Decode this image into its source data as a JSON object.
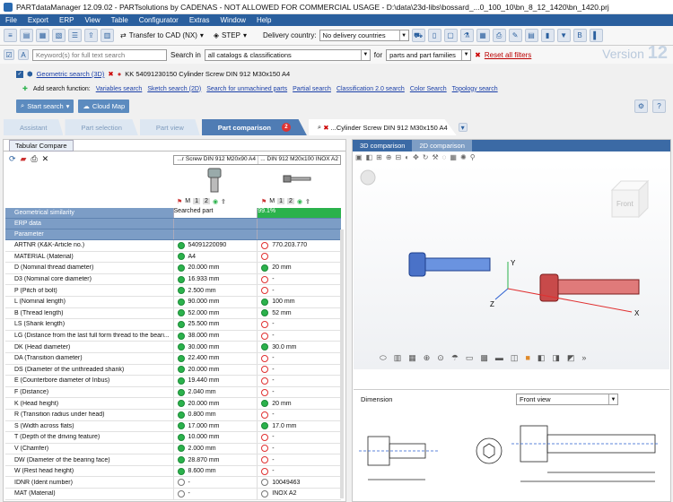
{
  "window": {
    "title": "PARTdataManager 12.09.02 - PARTsolutions by CADENAS - NOT ALLOWED FOR COMMERCIAL USAGE - D:\\data\\23d-libs\\bossard_...0_100_10\\bn_8_12_1420\\bn_1420.prj"
  },
  "menu": [
    "File",
    "Export",
    "ERP",
    "View",
    "Table",
    "Configurator",
    "Extras",
    "Window",
    "Help"
  ],
  "toolbar": {
    "transfer_label": "Transfer to CAD (NX)",
    "step_label": "STEP",
    "delivery_label": "Delivery country:",
    "delivery_value": "No delivery countries"
  },
  "search": {
    "placeholder": "Keyword(s) for full text search",
    "search_in_label": "Search in",
    "search_in_value": "all catalogs & classifications",
    "for_label": "for",
    "for_value": "parts and part families",
    "reset_label": "Reset all filters",
    "version_label": "Version",
    "version_number": "12"
  },
  "geometric": {
    "label": "Geometric search (3D)",
    "part": "KK 54091230150 Cylinder Screw DIN 912 M30x150 A4"
  },
  "functions": {
    "add_label": "Add search function:",
    "items": [
      "Variables search",
      "Sketch search (2D)",
      "Search for unmachined parts",
      "Partial search",
      "Classification 2.0 search",
      "Color Search",
      "Topology search"
    ]
  },
  "buttons": {
    "start_search": "Start search",
    "cloud_map": "Cloud Map"
  },
  "tabs": [
    {
      "label": "Assistant"
    },
    {
      "label": "Part selection"
    },
    {
      "label": "Part view"
    },
    {
      "label": "Part comparison",
      "badge": "2"
    },
    {
      "label": "...Cylinder Screw DIN 912 M30x150 A4"
    }
  ],
  "compare": {
    "tab_label": "Tabular Compare",
    "col1_header": "...r Screw DIN 912 M20x90 A4",
    "col2_header": "... DIN 912 M20x100 INOX A2",
    "searched_label": "Searched part",
    "similarity": "99.1%",
    "col1_number": "2",
    "col2_number": "2",
    "m_label": "M",
    "one_label": "1"
  },
  "sections": {
    "geometric": "Geometrical similarity",
    "erp": "ERP data",
    "parameter": "Parameter"
  },
  "rows": [
    {
      "name": "ARTNR (K&K-Article no.)",
      "v1": "54091220090",
      "v2": "770.203.770",
      "s1": "dot",
      "s2": "ring"
    },
    {
      "name": "MATERIAL (Material)",
      "v1": "A4",
      "v2": "",
      "s1": "dot",
      "s2": "ring"
    },
    {
      "name": "D (Nominal thread diameter)",
      "v1": "20.000 mm",
      "v2": "20 mm",
      "s1": "dot",
      "s2": "dot"
    },
    {
      "name": "D3 (Nominal core diameter)",
      "v1": "16.933 mm",
      "v2": "-",
      "s1": "dot",
      "s2": "ring"
    },
    {
      "name": "P (Pitch of bolt)",
      "v1": "2.500 mm",
      "v2": "-",
      "s1": "dot",
      "s2": "ring"
    },
    {
      "name": "L (Nominal length)",
      "v1": "90.000 mm",
      "v2": "100 mm",
      "s1": "dot",
      "s2": "dot"
    },
    {
      "name": "B (Thread length)",
      "v1": "52.000 mm",
      "v2": "52 mm",
      "s1": "dot",
      "s2": "dot"
    },
    {
      "name": "LS (Shank length)",
      "v1": "25.500 mm",
      "v2": "-",
      "s1": "dot",
      "s2": "ring"
    },
    {
      "name": "LG (Distance from the last full form thread to the beari...",
      "v1": "38.000 mm",
      "v2": "-",
      "s1": "dot",
      "s2": "ring"
    },
    {
      "name": "DK (Head diameter)",
      "v1": "30.000 mm",
      "v2": "30.0 mm",
      "s1": "dot",
      "s2": "dot"
    },
    {
      "name": "DA (Transition diameter)",
      "v1": "22.400 mm",
      "v2": "-",
      "s1": "dot",
      "s2": "ring"
    },
    {
      "name": "DS (Diameter of the unthreaded shank)",
      "v1": "20.000 mm",
      "v2": "-",
      "s1": "dot",
      "s2": "ring"
    },
    {
      "name": "E (Counterbore diameter of Inbus)",
      "v1": "19.440 mm",
      "v2": "-",
      "s1": "dot",
      "s2": "ring"
    },
    {
      "name": "F (Distance)",
      "v1": "2.040 mm",
      "v2": "-",
      "s1": "dot",
      "s2": "ring"
    },
    {
      "name": "K (Head height)",
      "v1": "20.000 mm",
      "v2": "20 mm",
      "s1": "dot",
      "s2": "dot"
    },
    {
      "name": "R (Transition radius under head)",
      "v1": "0.800 mm",
      "v2": "-",
      "s1": "dot",
      "s2": "ring"
    },
    {
      "name": "S (Width across flats)",
      "v1": "17.000 mm",
      "v2": "17.0 mm",
      "s1": "dot",
      "s2": "dot"
    },
    {
      "name": "T (Depth of the driving feature)",
      "v1": "10.000 mm",
      "v2": "-",
      "s1": "dot",
      "s2": "ring"
    },
    {
      "name": "V (Chamfer)",
      "v1": "2.000 mm",
      "v2": "-",
      "s1": "dot",
      "s2": "ring"
    },
    {
      "name": "DW (Diameter of the bearing face)",
      "v1": "28.870 mm",
      "v2": "-",
      "s1": "dot",
      "s2": "ring"
    },
    {
      "name": "W (Rest head height)",
      "v1": "8.600 mm",
      "v2": "-",
      "s1": "dot",
      "s2": "ring"
    },
    {
      "name": "IDNR (Ident number)",
      "v1": "-",
      "v2": "10049463",
      "s1": "ringd",
      "s2": "ringd"
    },
    {
      "name": "MAT (Material)",
      "v1": "-",
      "v2": "INOX A2",
      "s1": "ringd",
      "s2": "ringd"
    }
  ],
  "viewer": {
    "tab3d": "3D comparison",
    "tab2d": "2D comparison",
    "front": "Front",
    "axis_x": "X",
    "axis_y": "Y",
    "axis_z": "Z",
    "dimension_label": "Dimension",
    "view_select": "Front view"
  },
  "colors": {
    "accent": "#2a5f9e",
    "green": "#2bb24c",
    "red": "#e03030"
  }
}
